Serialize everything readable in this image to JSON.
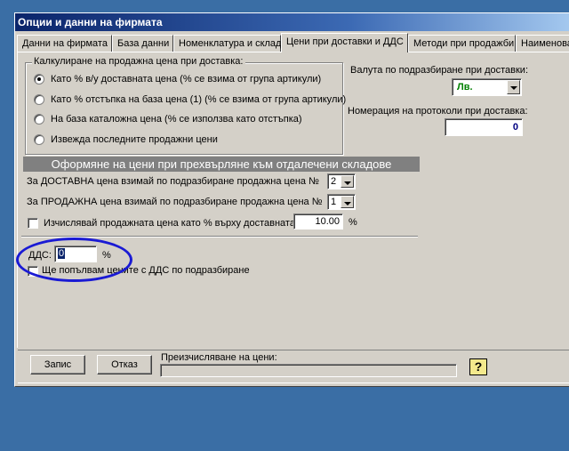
{
  "window": {
    "title": "Опции и данни на фирмата"
  },
  "tabs": [
    {
      "label": "Данни на фирмата"
    },
    {
      "label": "База данни"
    },
    {
      "label": "Номенклатура и склад"
    },
    {
      "label": "Цени при доставки и ДДС",
      "active": true
    },
    {
      "label": "Методи при продажби"
    },
    {
      "label": "Наименова"
    }
  ],
  "pricing_group": {
    "title": "Калкулиране на продажна цена при доставка:",
    "options": [
      {
        "label": "Като % в/у доставната цена (% се взима от група артикули)",
        "selected": true
      },
      {
        "label": "Като % отстъпка на база цена (1) (% се взима от група артикули)",
        "selected": false
      },
      {
        "label": "На база каталожна цена (% се използва като отстъпка)",
        "selected": false
      },
      {
        "label": "Извежда последните продажни цени",
        "selected": false
      }
    ]
  },
  "currency": {
    "label": "Валута по подразбиране при доставки:",
    "value": "Лв.",
    "value_color": "#008000"
  },
  "protocol_numbering": {
    "label": "Номерация на протоколи при доставка:",
    "value": "0"
  },
  "remote_warehouse": {
    "header": "Оформяне на цени при прехвърляне към отдалечени складове",
    "delivery_price_label": "За ДОСТАВНА цена взимай по подразбиране продажна цена №",
    "delivery_price_value": "2",
    "sale_price_label": "За ПРОДАЖНА цена взимай по подразбиране продажна цена №",
    "sale_price_value": "1",
    "calc_percent_label": "Изчислявай продажната цена като % върху доставната",
    "calc_percent_checked": false,
    "calc_percent_value": "10.00",
    "calc_percent_unit": "%"
  },
  "vat": {
    "label": "ДДС:",
    "value": "0",
    "unit": "%",
    "fill_with_vat_label": "Ще попълвам цените с ДДС по подразбиране",
    "fill_with_vat_checked": false
  },
  "footer": {
    "save_label": "Запис",
    "cancel_label": "Отказ",
    "recalc_label": "Преизчисляване на цени:",
    "help_icon": "?"
  },
  "annotation": {
    "color": "#1a1ad4"
  }
}
